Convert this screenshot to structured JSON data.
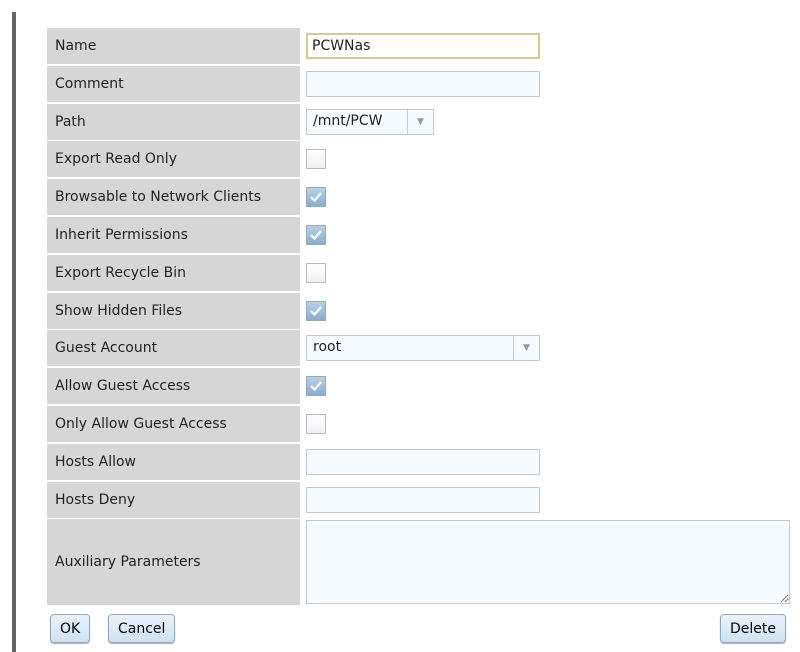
{
  "fields": [
    {
      "label": "Name",
      "type": "text",
      "value": "PCWNas"
    },
    {
      "label": "Comment",
      "type": "text",
      "value": ""
    },
    {
      "label": "Path",
      "type": "select",
      "value": "/mnt/PCW"
    },
    {
      "label": "Export Read Only",
      "type": "checkbox",
      "checked": false
    },
    {
      "label": "Browsable to Network Clients",
      "type": "checkbox",
      "checked": true
    },
    {
      "label": "Inherit Permissions",
      "type": "checkbox",
      "checked": true
    },
    {
      "label": "Export Recycle Bin",
      "type": "checkbox",
      "checked": false
    },
    {
      "label": "Show Hidden Files",
      "type": "checkbox",
      "checked": true
    },
    {
      "label": "Guest Account",
      "type": "select",
      "value": "root"
    },
    {
      "label": "Allow Guest Access",
      "type": "checkbox",
      "checked": true
    },
    {
      "label": "Only Allow Guest Access",
      "type": "checkbox",
      "checked": false
    },
    {
      "label": "Hosts Allow",
      "type": "text",
      "value": ""
    },
    {
      "label": "Hosts Deny",
      "type": "text",
      "value": ""
    },
    {
      "label": "Auxiliary Parameters",
      "type": "textarea",
      "value": ""
    }
  ],
  "buttons": {
    "ok": "OK",
    "cancel": "Cancel",
    "delete": "Delete"
  }
}
